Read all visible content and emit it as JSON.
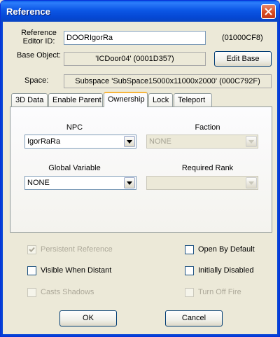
{
  "window": {
    "title": "Reference"
  },
  "ref_editor_id": {
    "label": "Reference Editor ID:",
    "value": "DOORIgorRa",
    "form_id": "(01000CF8)"
  },
  "base_object": {
    "label": "Base Object:",
    "value": "'ICDoor04' (0001D357)",
    "edit_button": "Edit Base"
  },
  "space": {
    "label": "Space:",
    "value": "Subspace 'SubSpace15000x11000x2000' (000C792F)"
  },
  "tabs": [
    {
      "label": "3D Data"
    },
    {
      "label": "Enable Parent"
    },
    {
      "label": "Ownership"
    },
    {
      "label": "Lock"
    },
    {
      "label": "Teleport"
    }
  ],
  "ownership": {
    "npc_label": "NPC",
    "npc_value": "IgorRaRa",
    "faction_label": "Faction",
    "faction_value": "NONE",
    "global_label": "Global Variable",
    "global_value": "NONE",
    "rank_label": "Required Rank",
    "rank_value": ""
  },
  "checks": {
    "persistent": "Persistent Reference",
    "open_default": "Open By Default",
    "visible_distant": "Visible When Distant",
    "init_disabled": "Initially Disabled",
    "casts_shadows": "Casts Shadows",
    "turn_off_fire": "Turn Off Fire"
  },
  "buttons": {
    "ok": "OK",
    "cancel": "Cancel"
  },
  "colors": {
    "title_blue": "#0547d3",
    "accent_orange": "#f7b53c",
    "close_red": "#d84a1f"
  }
}
